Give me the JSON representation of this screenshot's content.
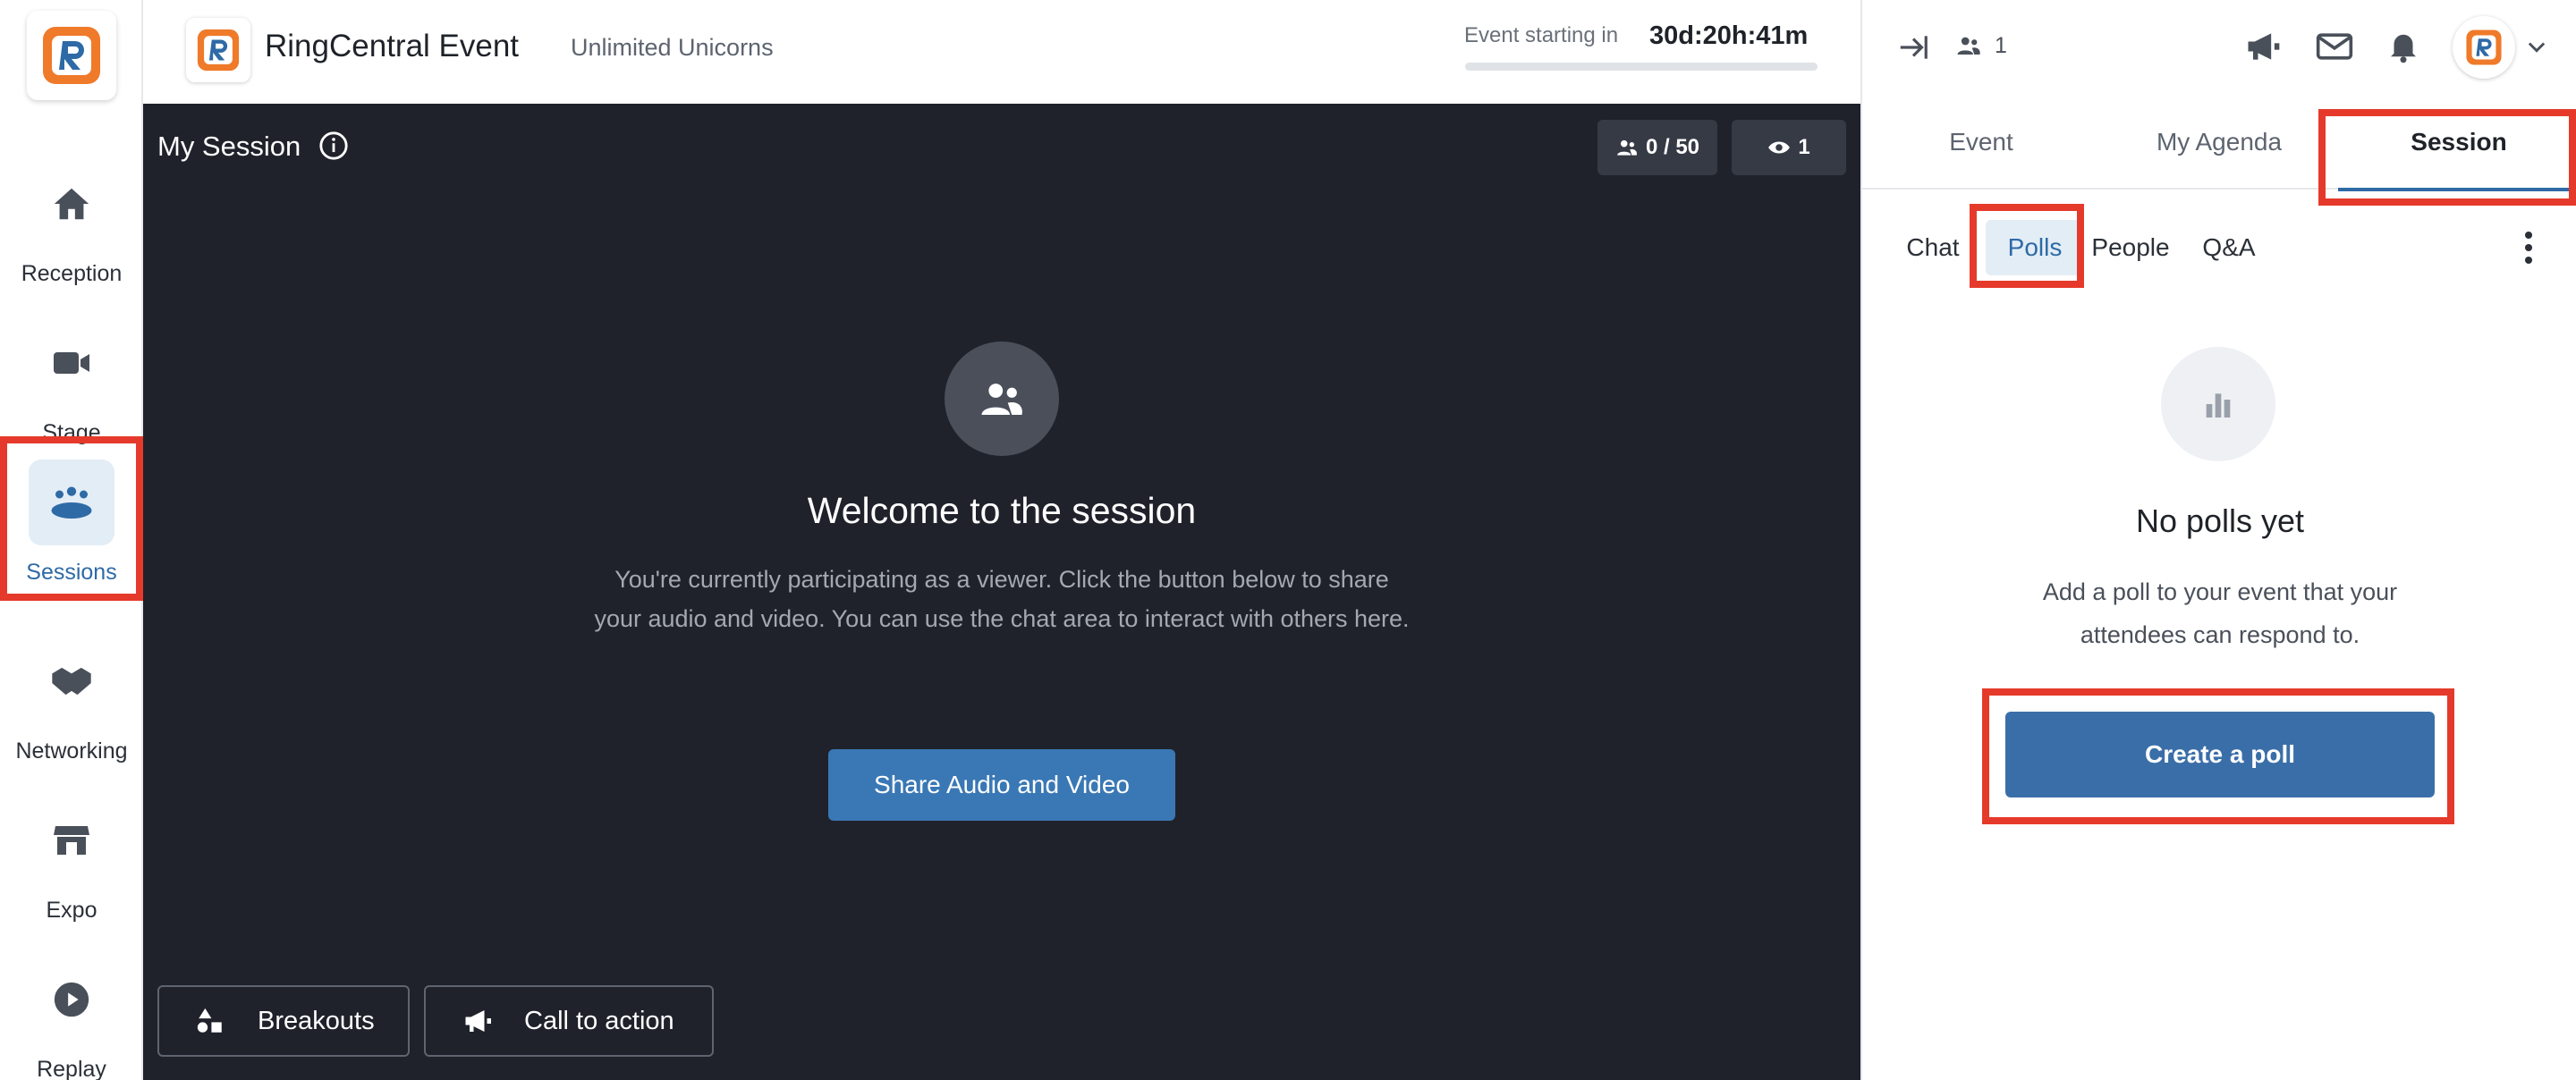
{
  "header": {
    "brand_name": "RingCentral Event",
    "org_name": "Unlimited Unicorns",
    "countdown_label": "Event starting in",
    "countdown_value": "30d:20h:41m"
  },
  "sidebar": {
    "items": [
      {
        "label": "Reception",
        "icon": "home-icon"
      },
      {
        "label": "Stage",
        "icon": "video-camera-icon"
      },
      {
        "label": "Sessions",
        "icon": "sessions-group-icon",
        "active": true
      },
      {
        "label": "Networking",
        "icon": "handshake-icon"
      },
      {
        "label": "Expo",
        "icon": "storefront-icon"
      },
      {
        "label": "Replay",
        "icon": "play-circle-icon"
      }
    ]
  },
  "stage": {
    "title": "My Session",
    "attendees": "0 / 50",
    "viewers": "1",
    "welcome_title": "Welcome to the session",
    "welcome_body": "You're currently participating as a viewer. Click the button below to share your audio and video. You can use the chat area to interact with others here.",
    "share_button": "Share Audio and Video",
    "breakouts_button": "Breakouts",
    "cta_button": "Call to action"
  },
  "panel": {
    "online_count": "1",
    "tabs": [
      "Event",
      "My Agenda",
      "Session"
    ],
    "active_tab": "Session",
    "subtabs": [
      "Chat",
      "Polls",
      "People",
      "Q&A"
    ],
    "active_subtab": "Polls",
    "empty_title": "No polls yet",
    "empty_body": "Add a poll to your event that your attendees can respond to.",
    "create_button": "Create a poll"
  },
  "colors": {
    "accent": "#2e6aa6",
    "stage_bg": "#1f222b",
    "highlight": "#e53a2b",
    "logo_orange": "#ef7a2a"
  }
}
